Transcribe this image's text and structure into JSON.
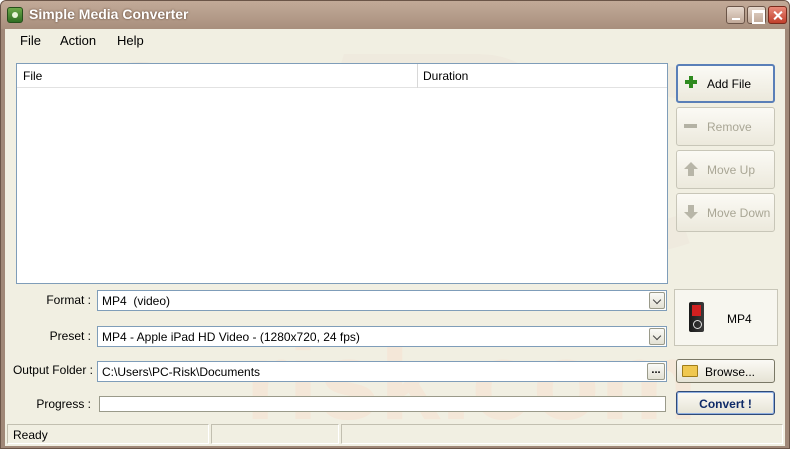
{
  "window": {
    "title": "Simple Media Converter"
  },
  "titlebar_buttons": [
    "minimize",
    "maximize",
    "close"
  ],
  "menu": {
    "items": [
      "File",
      "Action",
      "Help"
    ]
  },
  "file_list": {
    "columns": [
      "File",
      "Duration"
    ],
    "rows": []
  },
  "side_buttons": {
    "add_file": "Add File",
    "remove": "Remove",
    "move_up": "Move Up",
    "move_down": "Move Down"
  },
  "form": {
    "format_label": "Format :",
    "format_value": "MP4  (video)",
    "preset_label": "Preset :",
    "preset_value": "MP4 - Apple iPad HD Video - (1280x720, 24 fps)",
    "output_label": "Output Folder :",
    "output_value": "C:\\Users\\PC-Risk\\Documents",
    "output_browse_dots": "...",
    "progress_label": "Progress :",
    "progress_value": 0
  },
  "format_preview": {
    "label": "MP4",
    "icon": "media-player-icon"
  },
  "buttons": {
    "browse": "Browse...",
    "convert": "Convert !"
  },
  "status": {
    "text": "Ready"
  },
  "colors": {
    "titlebar": "#a88f7d",
    "client_bg": "#f1efe2",
    "accent_border": "#5a7fb8",
    "convert_text": "#0e2a68"
  }
}
